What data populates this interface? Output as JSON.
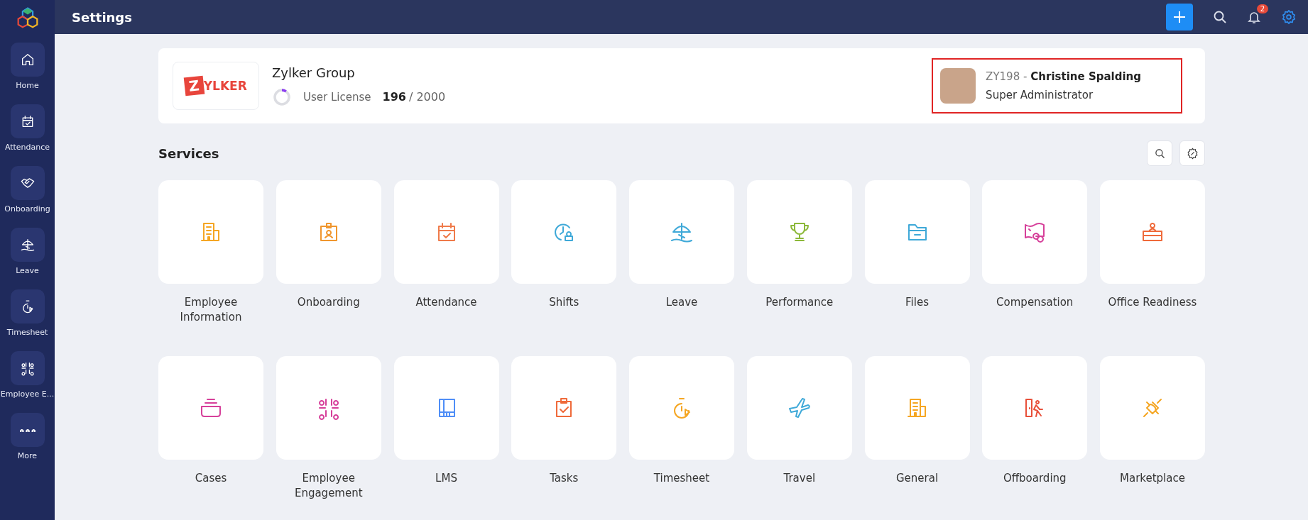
{
  "sidebar": {
    "items": [
      {
        "label": "Home",
        "kind": "home"
      },
      {
        "label": "Attendance",
        "kind": "calendar"
      },
      {
        "label": "Onboarding",
        "kind": "handshake"
      },
      {
        "label": "Leave",
        "kind": "umbrella"
      },
      {
        "label": "Timesheet",
        "kind": "timer"
      },
      {
        "label": "Employee E...",
        "kind": "engage"
      },
      {
        "label": "More",
        "kind": "dots"
      }
    ]
  },
  "topbar": {
    "title": "Settings",
    "notification_count": "2"
  },
  "organization": {
    "logo_letter": "Z",
    "logo_text": "YLKER",
    "name": "Zylker Group",
    "license_label": "User License",
    "license_used": "196",
    "license_total": "/ 2000",
    "level": 0.098
  },
  "profile": {
    "highlighted": true,
    "id": "ZY198 -",
    "name": "Christine Spalding",
    "role": "Super Administrator"
  },
  "services": {
    "title": "Services",
    "items": [
      {
        "label": "Employee Information",
        "kind": "building",
        "color": "#f5a623"
      },
      {
        "label": "Onboarding",
        "kind": "badge",
        "color": "#f0962e"
      },
      {
        "label": "Attendance",
        "kind": "calendar",
        "color": "#ef7a4a"
      },
      {
        "label": "Shifts",
        "kind": "shift",
        "color": "#3fa9d8"
      },
      {
        "label": "Leave",
        "kind": "umbrella",
        "color": "#3fa9d8"
      },
      {
        "label": "Performance",
        "kind": "trophy",
        "color": "#8cb83a"
      },
      {
        "label": "Files",
        "kind": "folder",
        "color": "#3fa9d8"
      },
      {
        "label": "Compensation",
        "kind": "money",
        "color": "#d6409a"
      },
      {
        "label": "Office Readiness",
        "kind": "desk",
        "color": "#ef6a3a"
      },
      {
        "label": "Cases",
        "kind": "case",
        "color": "#d6409a"
      },
      {
        "label": "Employee Engagement",
        "kind": "engage",
        "color": "#d6409a"
      },
      {
        "label": "LMS",
        "kind": "book",
        "color": "#4f8ef7"
      },
      {
        "label": "Tasks",
        "kind": "clipboard",
        "color": "#ef6a3a"
      },
      {
        "label": "Timesheet",
        "kind": "timer",
        "color": "#f5a623"
      },
      {
        "label": "Travel",
        "kind": "plane",
        "color": "#3fa9d8"
      },
      {
        "label": "General",
        "kind": "building",
        "color": "#f5a623"
      },
      {
        "label": "Offboarding",
        "kind": "exit",
        "color": "#e8503a"
      },
      {
        "label": "Marketplace",
        "kind": "plug",
        "color": "#f5a623"
      }
    ]
  }
}
